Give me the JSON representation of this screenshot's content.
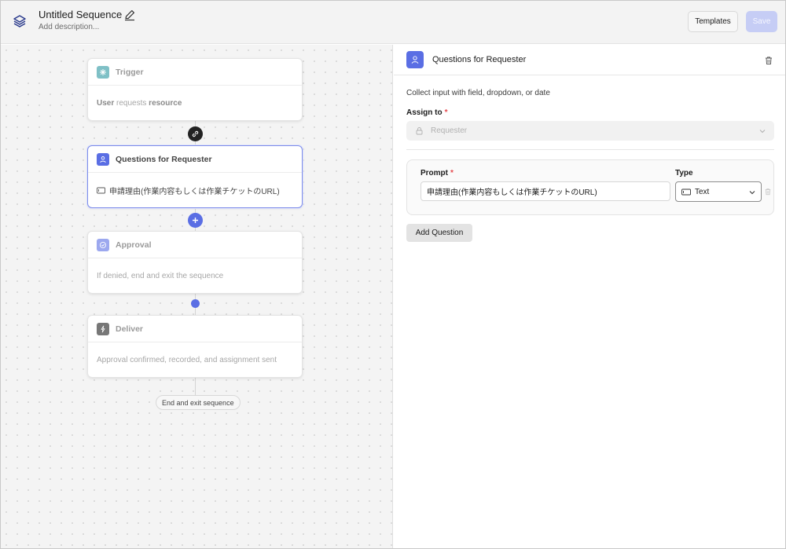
{
  "header": {
    "title": "Untitled Sequence",
    "description": "Add description...",
    "templates_label": "Templates",
    "save_label": "Save"
  },
  "canvas": {
    "cards": [
      {
        "title": "Trigger",
        "body_parts": [
          "User",
          " requests ",
          "resource"
        ]
      },
      {
        "title": "Questions for Requester",
        "body": "申請理由(作業内容もしくは作業チケットのURL)"
      },
      {
        "title": "Approval",
        "body": "If denied, end and exit the sequence"
      },
      {
        "title": "Deliver",
        "body": "Approval confirmed, recorded, and assignment sent"
      }
    ],
    "end_label": "End and exit sequence"
  },
  "panel": {
    "title": "Questions for Requester",
    "subtitle": "Collect input with field, dropdown, or date",
    "assign_label": "Assign to",
    "assign_value": "Requester",
    "prompt_label": "Prompt",
    "type_label": "Type",
    "prompt_value": "申請理由(作業内容もしくは作業チケットのURL)",
    "type_value": "Text",
    "add_question_label": "Add Question",
    "required_mark": "*"
  },
  "colors": {
    "accent": "#5a6ee4",
    "save_disabled": "#c6cdf5",
    "required": "#e5484d"
  },
  "icons": [
    "layers-icon",
    "edit-icon",
    "trigger-icon",
    "user-icon",
    "link-icon",
    "plus-icon",
    "check-circle-icon",
    "bolt-icon",
    "trash-icon",
    "lock-icon",
    "chevron-down-icon",
    "text-field-icon"
  ]
}
